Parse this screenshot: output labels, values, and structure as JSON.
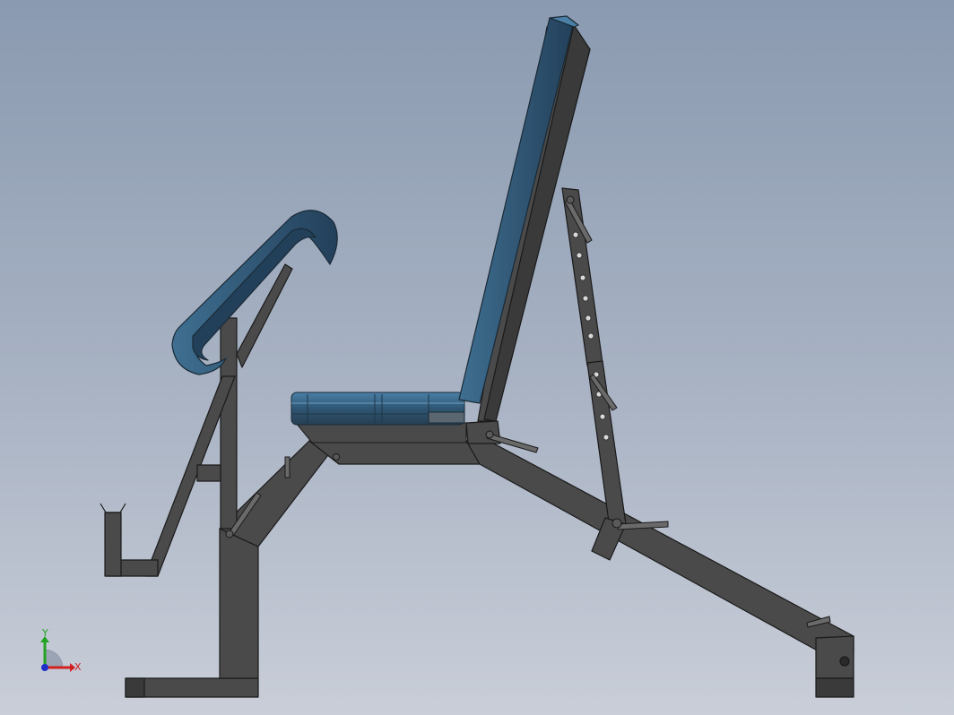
{
  "viewport": {
    "triad": {
      "y_label": "Y",
      "x_label": "X"
    }
  },
  "colors": {
    "frame_fill": "#4a4a4a",
    "frame_dark": "#333333",
    "frame_edge": "#1a1a1a",
    "pad_fill": "#2f4f66",
    "pad_light": "#3f6f91",
    "pin_fill": "#6a6a6a",
    "hole_fill": "#d8d8d8",
    "axis_x": "#d21f1f",
    "axis_y": "#22a322",
    "axis_z": "#1f2fc8"
  }
}
